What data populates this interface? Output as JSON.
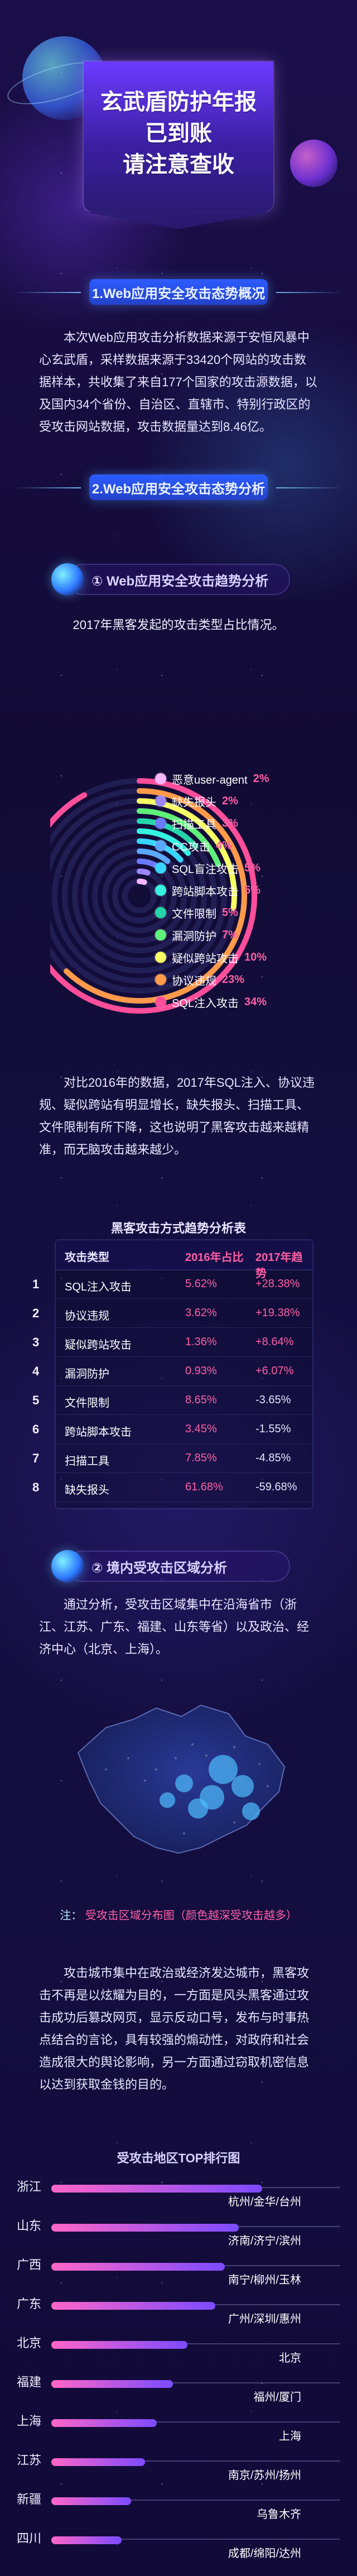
{
  "hero": {
    "title_lines": [
      "玄武盾防护年报",
      "已到账",
      "请注意查收"
    ]
  },
  "sections": {
    "s1_title": "1.Web应用安全攻击态势概况",
    "s1_text": "本次Web应用攻击分析数据来源于安恒风暴中心玄武盾，采样数据来源于33420个网站的攻击数据样本，共收集了来自177个国家的攻击源数据，以及国内34个省份、自治区、直辖市、特别行政区的受攻击网站数据，攻击数据量达到8.46亿。",
    "s2_title": "2.Web应用安全攻击态势分析",
    "sub1": "① Web应用安全攻击趋势分析",
    "sub1_caption": "2017年黑客发起的攻击类型占比情况。",
    "attack_types": [
      {
        "label": "恶意user-agent",
        "pct": "2%",
        "color": "#f7b6ff"
      },
      {
        "label": "缺失报头",
        "pct": "2%",
        "color": "#9d86ff"
      },
      {
        "label": "扫描工具",
        "pct": "3%",
        "color": "#6a7bff"
      },
      {
        "label": "CC攻击",
        "pct": "4%",
        "color": "#5aa7ff"
      },
      {
        "label": "SQL盲注攻击",
        "pct": "5%",
        "color": "#38d6ff"
      },
      {
        "label": "跨站脚本攻击",
        "pct": "5%",
        "color": "#36f1e0"
      },
      {
        "label": "文件限制",
        "pct": "5%",
        "color": "#24d6a8"
      },
      {
        "label": "漏洞防护",
        "pct": "7%",
        "color": "#5ff07a"
      },
      {
        "label": "疑似跨站攻击",
        "pct": "10%",
        "color": "#f6ff64"
      },
      {
        "label": "协议违规",
        "pct": "23%",
        "color": "#ff9a4b"
      },
      {
        "label": "SQL注入攻击",
        "pct": "34%",
        "color": "#ff4e9a"
      }
    ],
    "trend_text": "对比2016年的数据，2017年SQL注入、协议违规、疑似跨站有明显增长，缺失报头、扫描工具、文件限制有所下降，这也说明了黑客攻击越来越精准，而无脑攻击越来越少。",
    "table_title": "黑客攻击方式趋势分析表",
    "table_headers": [
      "攻击类型",
      "2016年占比",
      "2017年趋势"
    ],
    "table_rows": [
      {
        "idx": "1",
        "type": "SQL注入攻击",
        "p2016": "5.62%",
        "trend": "+28.38%",
        "trend_color": "#ff5fa4"
      },
      {
        "idx": "2",
        "type": "协议违规",
        "p2016": "3.62%",
        "trend": "+19.38%",
        "trend_color": "#ff5fa4"
      },
      {
        "idx": "3",
        "type": "疑似跨站攻击",
        "p2016": "1.36%",
        "trend": "+8.64%",
        "trend_color": "#ff5fa4"
      },
      {
        "idx": "4",
        "type": "漏洞防护",
        "p2016": "0.93%",
        "trend": "+6.07%",
        "trend_color": "#ff5fa4"
      },
      {
        "idx": "5",
        "type": "文件限制",
        "p2016": "8.65%",
        "trend": "-3.65%",
        "trend_color": "#e8e6ff"
      },
      {
        "idx": "6",
        "type": "跨站脚本攻击",
        "p2016": "3.45%",
        "trend": "-1.55%",
        "trend_color": "#e8e6ff"
      },
      {
        "idx": "7",
        "type": "扫描工具",
        "p2016": "7.85%",
        "trend": "-4.85%",
        "trend_color": "#e8e6ff"
      },
      {
        "idx": "8",
        "type": "缺失报头",
        "p2016": "61.68%",
        "trend": "-59.68%",
        "trend_color": "#e8e6ff"
      }
    ],
    "sub2": "② 境内受攻击区域分析",
    "region_text": "通过分析，受攻击区域集中在沿海省市（浙江、江苏、广东、福建、山东等省）以及政治、经济中心（北京、上海）。",
    "map_note_prefix": "注：",
    "map_note_main": "受攻击区域分布图（颜色越深受攻击越多）",
    "region_text2": "攻击城市集中在政治或经济发达城市，黑客攻击不再是以炫耀为目的，一方面是风头黑客通过攻击成功后篡改网页，显示反动口号，发布与时事热点结合的言论，具有较强的煽动性，对政府和社会造成很大的舆论影响，另一方面通过窃取机密信息以达到获取金钱的目的。",
    "rank_title": "受攻击地区TOP排行图",
    "rank": [
      {
        "prov": "浙江",
        "cities": "杭州/金华/台州",
        "level": 0.9
      },
      {
        "prov": "山东",
        "cities": "济南/济宁/滨州",
        "level": 0.8
      },
      {
        "prov": "广西",
        "cities": "南宁/柳州/玉林",
        "level": 0.74
      },
      {
        "prov": "广东",
        "cities": "广州/深圳/惠州",
        "level": 0.7
      },
      {
        "prov": "北京",
        "cities": "北京",
        "level": 0.58
      },
      {
        "prov": "福建",
        "cities": "福州/厦门",
        "level": 0.52
      },
      {
        "prov": "上海",
        "cities": "上海",
        "level": 0.45
      },
      {
        "prov": "江苏",
        "cities": "南京/苏州/扬州",
        "level": 0.4
      },
      {
        "prov": "新疆",
        "cities": "乌鲁木齐",
        "level": 0.34
      },
      {
        "prov": "四川",
        "cities": "成都/绵阳/达州",
        "level": 0.3
      }
    ]
  }
}
